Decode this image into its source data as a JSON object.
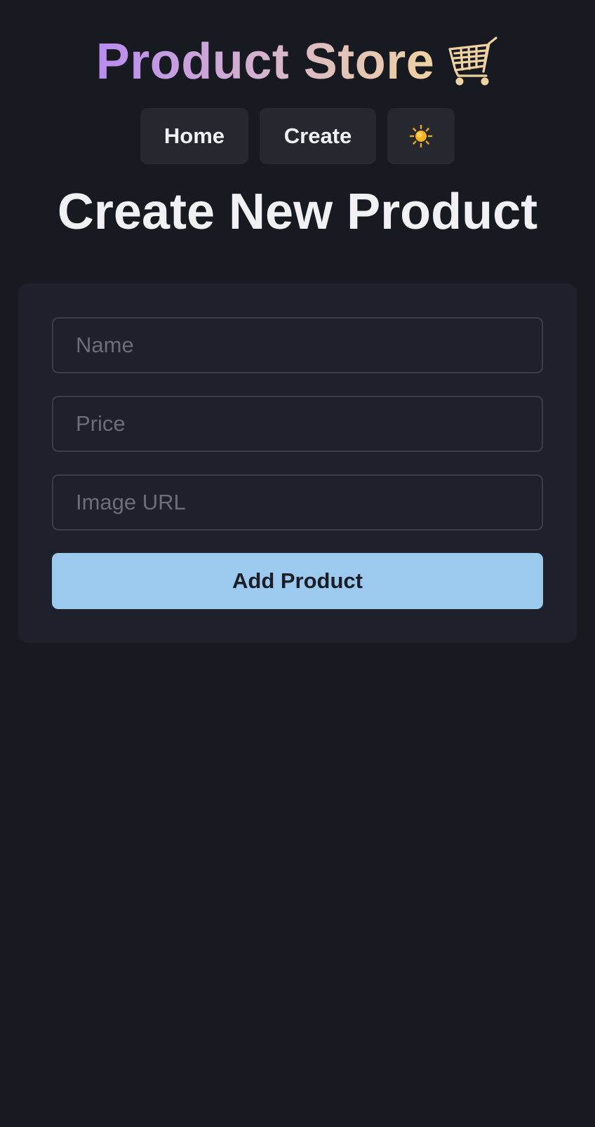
{
  "brand": {
    "title": "Product Store",
    "icon": "shopping-cart-icon",
    "gradient": [
      "#b98af0",
      "#d8b8c8",
      "#f0d2a2"
    ]
  },
  "nav": {
    "home_label": "Home",
    "create_label": "Create",
    "theme_icon": "sun-icon"
  },
  "page": {
    "title": "Create New Product"
  },
  "form": {
    "name_placeholder": "Name",
    "price_placeholder": "Price",
    "image_placeholder": "Image URL",
    "name_value": "",
    "price_value": "",
    "image_value": "",
    "submit_label": "Add Product"
  },
  "colors": {
    "background": "#181a22",
    "card": "#1e212b",
    "nav_button": "#262830",
    "accent": "#9ccaee"
  }
}
